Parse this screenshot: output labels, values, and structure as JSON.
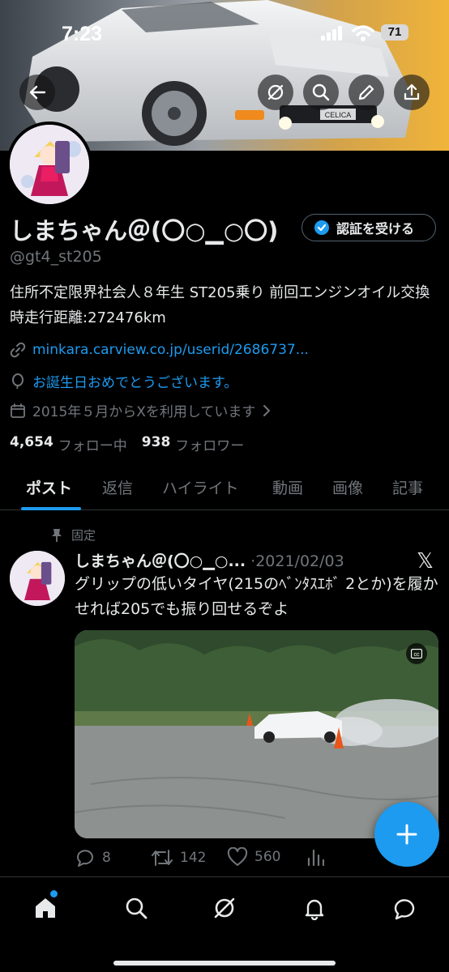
{
  "status_bar": {
    "time": "7:23",
    "battery": "71"
  },
  "header": {
    "back_icon": "arrow-left-icon",
    "grok_icon": "grok-icon",
    "search_icon": "search-icon",
    "edit_icon": "pencil-icon",
    "share_icon": "share-icon",
    "banner_badge": "CELICA"
  },
  "profile": {
    "name": "しまちゃん＠(〇○▁○〇)",
    "handle": "@gt4_st205",
    "verify_label": "認証を受ける",
    "bio": "住所不定限界社会人８年生 ST205乗り 前回エンジンオイル交換時走行距離:272476km",
    "url": "minkara.carview.co.jp/userid/2686737...",
    "birthday": "お誕生日おめでとうございます。",
    "joined": "2015年５月からXを利用しています",
    "following_count": "4,654",
    "following_label": "フォロー中",
    "followers_count": "938",
    "followers_label": "フォロワー"
  },
  "tabs": [
    {
      "label": "ポスト",
      "active": true
    },
    {
      "label": "返信"
    },
    {
      "label": "ハイライト"
    },
    {
      "label": "動画"
    },
    {
      "label": "画像"
    },
    {
      "label": "記事"
    }
  ],
  "post": {
    "pinned_label": "固定",
    "author": "しまちゃん＠(〇○▁○...",
    "date": "·2021/02/03",
    "x_logo": "𝕏",
    "text": "グリップの低いタイヤ(215のﾍﾞﾝﾀｽｴﾎﾞ 2とか)を履かせれば205でも振り回せるぞよ",
    "replies": "8",
    "reposts": "142",
    "likes": "560"
  },
  "colors": {
    "accent": "#1d9bf0",
    "muted": "#71767b",
    "text": "#e7e9ea",
    "background": "#000000"
  }
}
